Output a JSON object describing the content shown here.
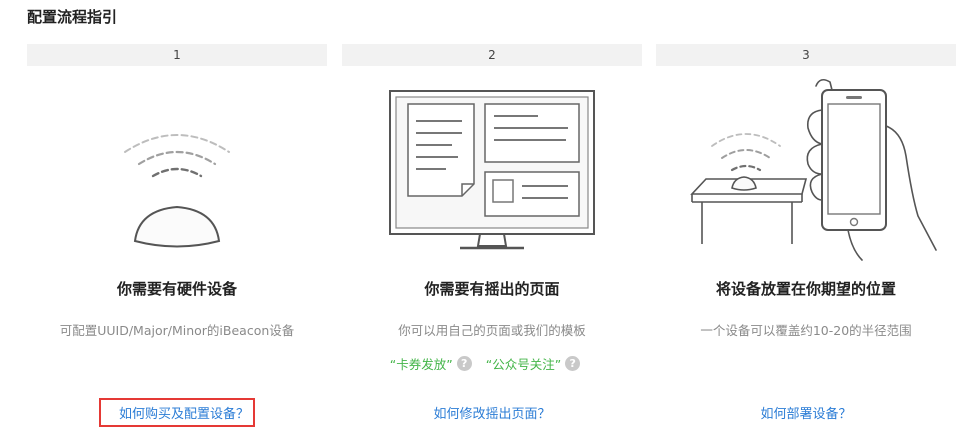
{
  "page_title": "配置流程指引",
  "steps": [
    {
      "number": "1",
      "title": "你需要有硬件设备",
      "description": "可配置UUID/Major/Minor的iBeacon设备",
      "link": "如何购买及配置设备？"
    },
    {
      "number": "2",
      "title": "你需要有摇出的页面",
      "description": "你可以用自己的页面或我们的模板",
      "tags": [
        "“卡券发放”",
        "“公众号关注”"
      ],
      "link": "如何修改摇出页面？"
    },
    {
      "number": "3",
      "title": "将设备放置在你期望的位置",
      "description": "一个设备可以覆盖约10-20的半径范围",
      "link": "如何部署设备？"
    }
  ],
  "help_icon_glyph": "?",
  "colors": {
    "link": "#2c7dd6",
    "tag_green": "#44b549",
    "highlight_red": "#e53935",
    "step_bar_bg": "#f2f2f2"
  }
}
